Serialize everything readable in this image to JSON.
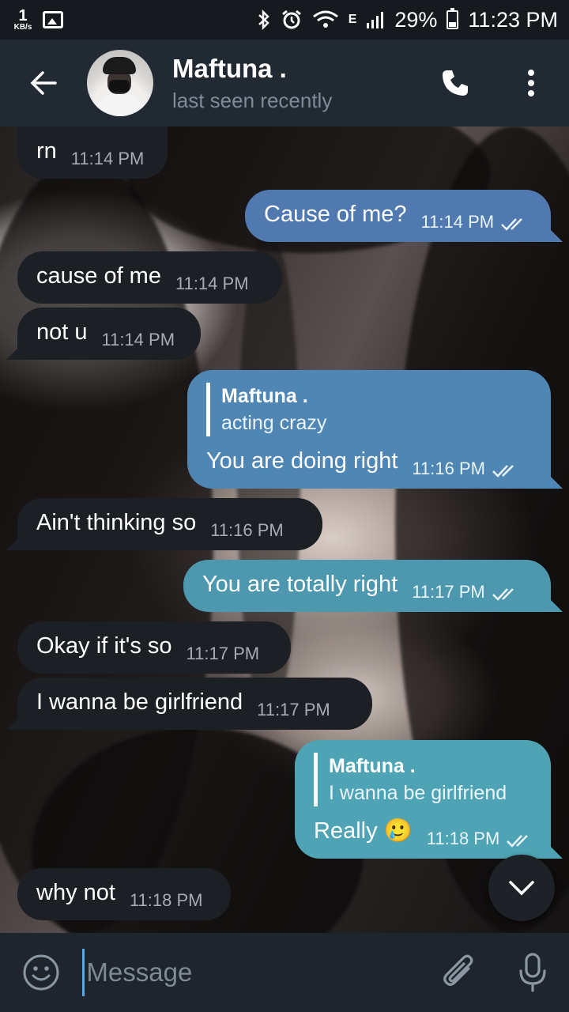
{
  "status_bar": {
    "net_speed_value": "1",
    "net_speed_unit": "KB/s",
    "network_type": "E",
    "battery": "29%",
    "time": "11:23 PM",
    "icons": [
      "gallery-icon",
      "bluetooth-icon",
      "alarm-icon",
      "wifi-icon",
      "signal-icon",
      "battery-icon"
    ]
  },
  "header": {
    "contact_name": "Maftuna .",
    "contact_status": "last seen recently",
    "icons": [
      "back-arrow-icon",
      "phone-icon",
      "more-vertical-icon"
    ]
  },
  "messages": [
    {
      "direction": "in",
      "text": "rn",
      "time": "11:14 PM"
    },
    {
      "direction": "out",
      "text": "Cause of me?",
      "time": "11:14 PM",
      "read": true
    },
    {
      "direction": "in",
      "text": "cause of me",
      "time": "11:14 PM"
    },
    {
      "direction": "in",
      "text": "not u",
      "time": "11:14 PM"
    },
    {
      "direction": "out",
      "reply_to": {
        "name": "Maftuna .",
        "text": "acting crazy"
      },
      "text": "You are doing right",
      "time": "11:16 PM",
      "read": true
    },
    {
      "direction": "in",
      "text": "Ain't thinking so",
      "time": "11:16 PM"
    },
    {
      "direction": "out",
      "text": "You are totally right",
      "time": "11:17 PM",
      "read": true
    },
    {
      "direction": "in",
      "text": "Okay if it's so",
      "time": "11:17 PM"
    },
    {
      "direction": "in",
      "text": "I wanna be girlfriend",
      "time": "11:17 PM"
    },
    {
      "direction": "out",
      "reply_to": {
        "name": "Maftuna .",
        "text": "I wanna be girlfriend"
      },
      "text": "Really 🥲",
      "time": "11:18 PM",
      "read": true
    },
    {
      "direction": "in",
      "text": "why not",
      "time": "11:18 PM"
    }
  ],
  "composer": {
    "placeholder": "Message",
    "value": "",
    "icons": [
      "emoji-icon",
      "attach-icon",
      "microphone-icon",
      "chevron-down-icon"
    ]
  },
  "colors": {
    "header_bg": "#212932",
    "incoming_bubble": "#1c1f23",
    "outgoing_bubble": "#4f86b3",
    "accent": "#5fa8e0"
  }
}
